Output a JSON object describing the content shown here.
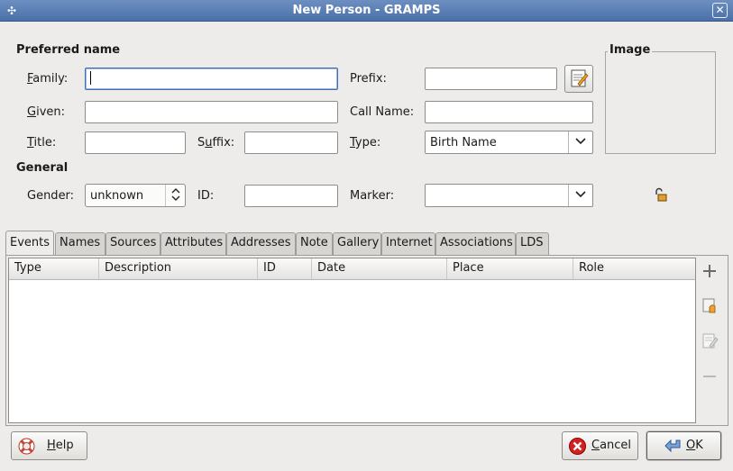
{
  "window": {
    "title": "New Person - GRAMPS"
  },
  "preferred_name": {
    "section_title": "Preferred name",
    "family_label": "Family:",
    "family_mnemonic": "F",
    "family_rest": "amily:",
    "family_value": "",
    "prefix_label": "Prefix:",
    "prefix_value": "",
    "given_label": "Given:",
    "given_mnemonic": "G",
    "given_rest": "iven:",
    "given_value": "",
    "callname_label": "Call Name:",
    "callname_value": "",
    "title_label": "Title:",
    "title_mnemonic": "T",
    "title_rest": "itle:",
    "title_value": "",
    "suffix_label": "Suffix:",
    "suffix_pre": "S",
    "suffix_mnemonic": "u",
    "suffix_rest": "ffix:",
    "suffix_value": "",
    "type_label": "Type:",
    "type_mnemonic": "T",
    "type_rest": "ype:",
    "type_value": "Birth Name"
  },
  "image_frame": {
    "label": "Image"
  },
  "general": {
    "section_title": "General",
    "gender_label": "Gender:",
    "gender_value": "unknown",
    "id_label": "ID:",
    "id_value": "",
    "marker_label": "Marker:",
    "marker_value": ""
  },
  "tabs": [
    "Events",
    "Names",
    "Sources",
    "Attributes",
    "Addresses",
    "Note",
    "Gallery",
    "Internet",
    "Associations",
    "LDS"
  ],
  "active_tab": "Events",
  "events_table": {
    "columns": [
      "Type",
      "Description",
      "ID",
      "Date",
      "Place",
      "Role"
    ],
    "rows": []
  },
  "footer": {
    "help_label": "Help",
    "help_mnemonic": "H",
    "help_rest": "elp",
    "cancel_label": "Cancel",
    "cancel_mnemonic": "C",
    "cancel_rest": "ancel",
    "ok_label": "OK",
    "ok_mnemonic": "O",
    "ok_rest": "K"
  },
  "icons": {
    "window_menu": "window-menu-icon",
    "close": "close-icon",
    "edit_name": "edit-name-icon",
    "privacy_lock": "unlocked-padlock-icon",
    "add": "add-icon",
    "share": "share-existing-icon",
    "edit": "edit-icon",
    "remove": "remove-icon",
    "help": "lifebuoy-icon",
    "cancel": "cancel-icon",
    "ok": "ok-arrow-icon"
  },
  "colors": {
    "titlebar": "#4a70a8",
    "focus": "#3f6fb0",
    "window_bg": "#edeceb"
  }
}
